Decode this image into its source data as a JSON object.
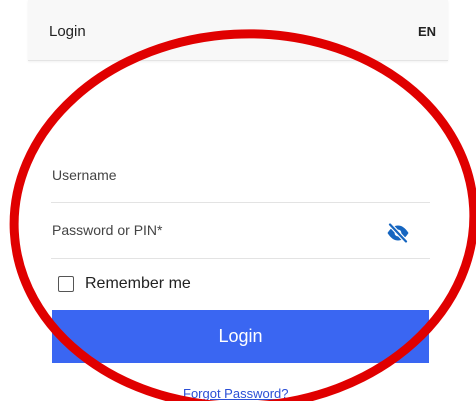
{
  "header": {
    "title": "Login",
    "language": "EN"
  },
  "form": {
    "username_label": "Username",
    "password_label": "Password or PIN*",
    "remember_label": "Remember me",
    "remember_checked": false,
    "submit_label": "Login",
    "forgot_label": "Forgot Password?"
  },
  "icons": {
    "password_toggle": "eye-slash-icon"
  },
  "colors": {
    "accent": "#3a66f2",
    "annotation": "#e00000",
    "link": "#2b4fd6"
  }
}
